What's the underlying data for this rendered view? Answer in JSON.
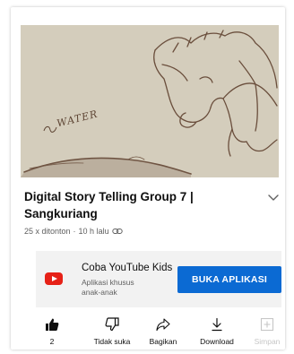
{
  "video": {
    "overlay_text": "WATER",
    "title": "Digital Story Telling Group 7 | Sangkuriang",
    "views": "25 x ditonton",
    "separator": "·",
    "uploaded": "10 h lalu"
  },
  "kids_promo": {
    "title": "Coba YouTube Kids",
    "subtitle": "Aplikasi khusus anak-anak",
    "button_label": "BUKA APLIKASI",
    "logo_color": "#e62117",
    "button_color": "#0b6ad3"
  },
  "actions": {
    "like_count": "2",
    "dislike_label": "Tidak suka",
    "share_label": "Bagikan",
    "download_label": "Download",
    "save_label": "Simpan"
  }
}
